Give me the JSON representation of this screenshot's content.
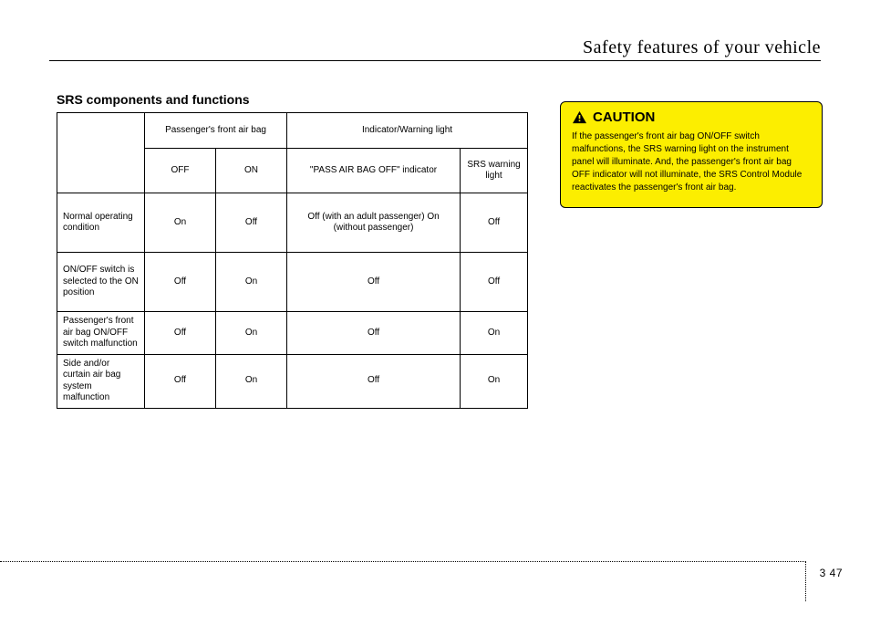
{
  "header": {
    "title": "Safety features of your vehicle"
  },
  "section_heading": "SRS components and functions",
  "table": {
    "col_group_a": "Passenger's front air bag",
    "col_group_b": "Indicator/Warning light",
    "col_a1": "OFF",
    "col_a2": "ON",
    "col_b1": "\"PASS AIR BAG OFF\" indicator",
    "col_b2": "SRS warning light",
    "rows": [
      {
        "label": "Normal operating condition",
        "a1": "On",
        "a2": "Off",
        "b1": "Off (with an adult passenger)\nOn (without passenger)",
        "b2": "Off"
      },
      {
        "label": "ON/OFF switch is selected to the ON position",
        "a1": "Off",
        "a2": "On",
        "b1": "Off",
        "b2": "Off"
      },
      {
        "label": "Passenger's front air bag ON/OFF switch malfunction",
        "a1": "Off",
        "a2": "On",
        "b1": "Off",
        "b2": "On"
      },
      {
        "label": "Side and/or curtain air bag system malfunction",
        "a1": "Off",
        "a2": "On",
        "b1": "Off",
        "b2": "On"
      }
    ]
  },
  "caution": {
    "heading": "CAUTION",
    "body": "If the passenger's front air bag ON/OFF switch malfunctions, the SRS warning light on the instrument panel will illuminate. And, the passenger's front air bag OFF indicator will not illuminate, the SRS Control Module reactivates the passenger's front air bag."
  },
  "footer": {
    "page": "3 47"
  }
}
